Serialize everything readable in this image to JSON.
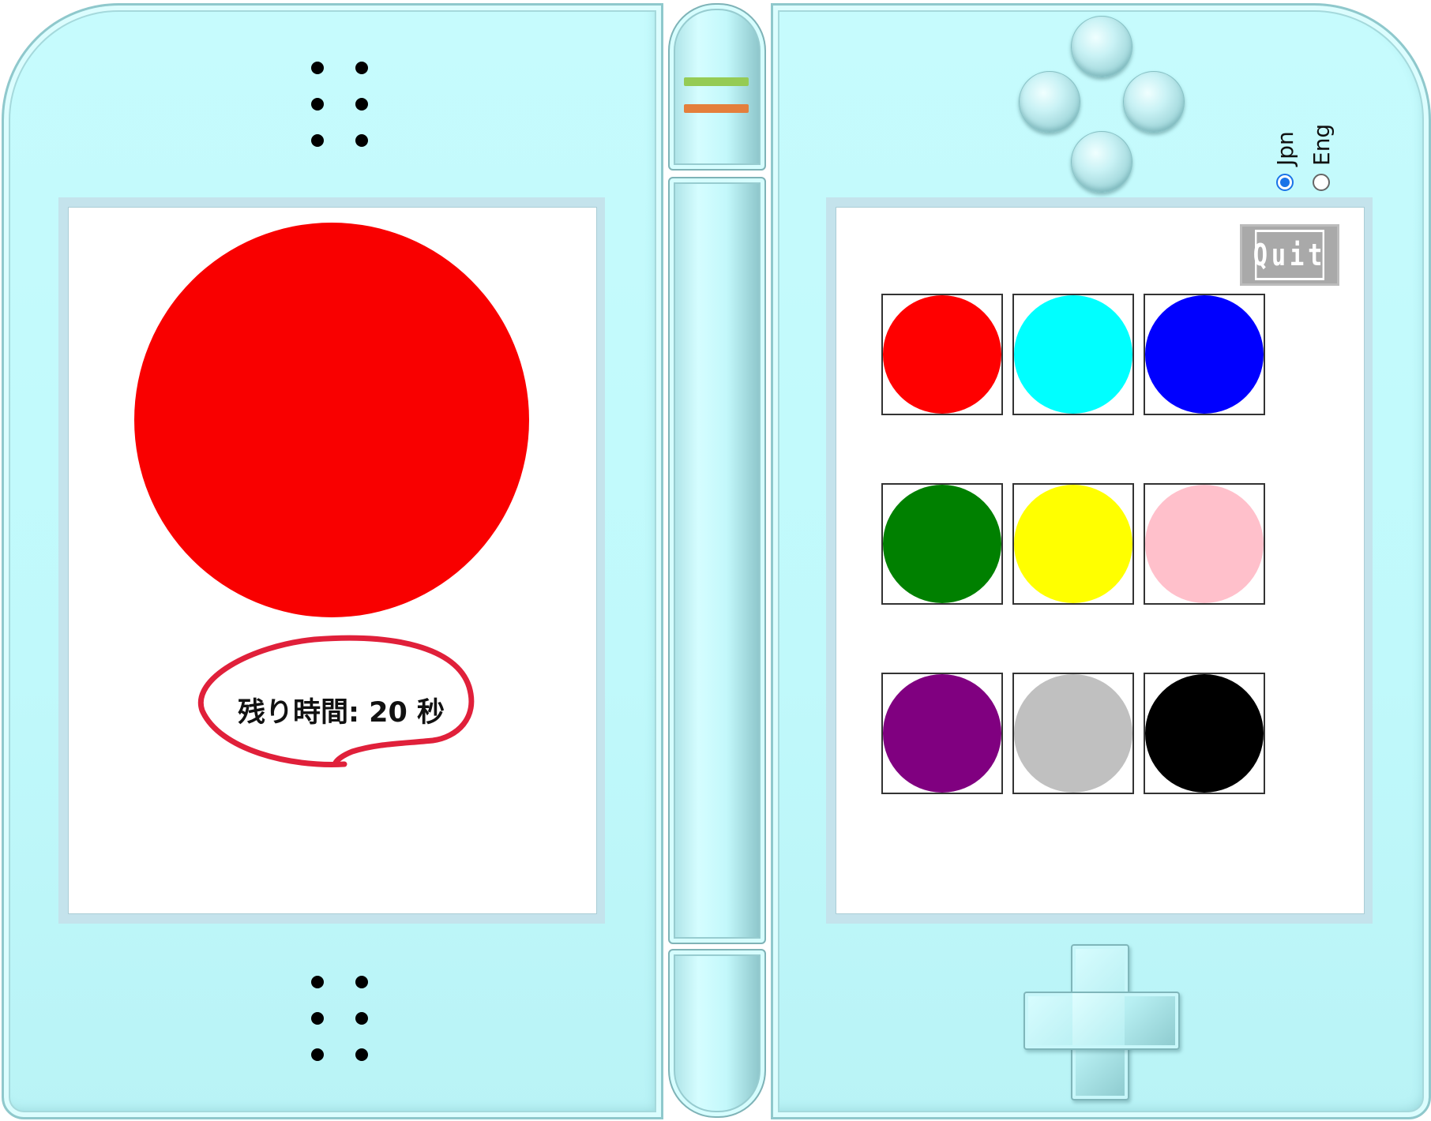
{
  "game": {
    "target_color": "#f90000",
    "timer_text": "残り時間: 20 秒",
    "timer_highlight_color": "#e0203a"
  },
  "quit_button": {
    "label": "Quit"
  },
  "language": {
    "options": [
      {
        "label": "Jpn",
        "selected": true
      },
      {
        "label": "Eng",
        "selected": false
      }
    ]
  },
  "palette": {
    "swatches": [
      {
        "name": "red",
        "color": "#ff0000"
      },
      {
        "name": "cyan",
        "color": "#00ffff"
      },
      {
        "name": "blue",
        "color": "#0000ff"
      },
      {
        "name": "green",
        "color": "#008000"
      },
      {
        "name": "yellow",
        "color": "#ffff00"
      },
      {
        "name": "pink",
        "color": "#ffc0cb"
      },
      {
        "name": "purple",
        "color": "#800080"
      },
      {
        "name": "silver",
        "color": "#c0c0c0"
      },
      {
        "name": "black",
        "color": "#000000"
      }
    ]
  },
  "device": {
    "led_colors": [
      "#95cb55",
      "#e47f3c"
    ],
    "body_color": "#c0f9fb"
  }
}
